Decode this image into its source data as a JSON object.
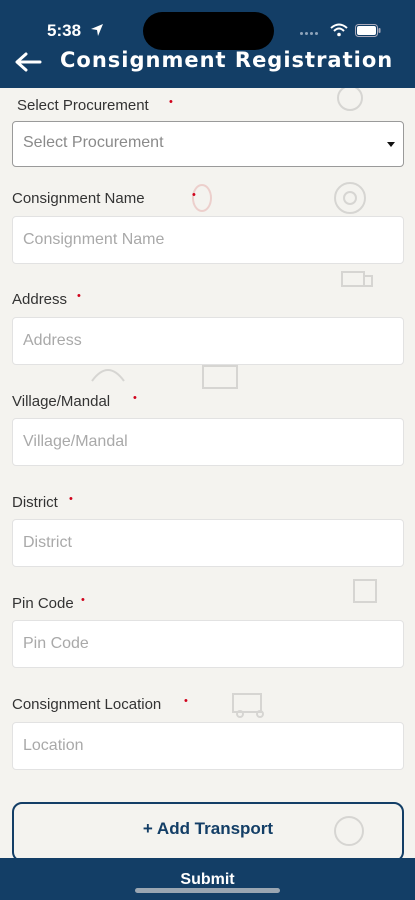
{
  "status_bar": {
    "time": "5:38"
  },
  "header": {
    "title": "Consignment Registration",
    "background_color": "#133e66"
  },
  "form": {
    "procurement": {
      "label": "Select Procurement",
      "required_mark": "•",
      "selected_value": "Select Procurement"
    },
    "consignment_name": {
      "label": "Consignment Name",
      "required_mark": "•",
      "placeholder": "Consignment Name"
    },
    "address": {
      "label": "Address",
      "required_mark": "•",
      "placeholder": "Address"
    },
    "village_mandal": {
      "label": "Village/Mandal",
      "required_mark": "•",
      "placeholder": "Village/Mandal"
    },
    "district": {
      "label": "District",
      "required_mark": "•",
      "placeholder": "District"
    },
    "pin_code": {
      "label": "Pin Code",
      "required_mark": "•",
      "placeholder": "Pin Code"
    },
    "consignment_location": {
      "label": "Consignment Location",
      "required_mark": "•",
      "placeholder": "Location"
    }
  },
  "actions": {
    "add_transport_label": "+ Add Transport",
    "submit_label": "Submit"
  },
  "icons": {
    "back": "back-arrow-icon",
    "location": "location-arrow-icon",
    "wifi": "wifi-icon",
    "battery": "battery-icon",
    "dropdown": "caret-down-icon"
  }
}
